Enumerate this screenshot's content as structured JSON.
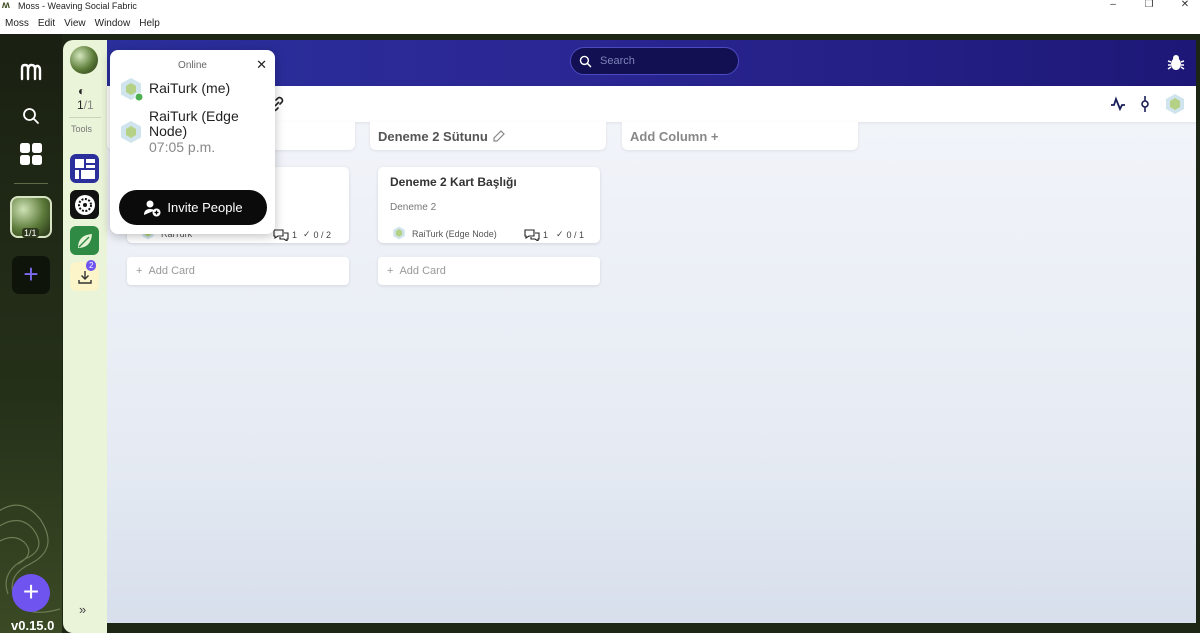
{
  "window": {
    "title": "Moss - Weaving Social Fabric",
    "controls": [
      "minimize",
      "restore",
      "close"
    ]
  },
  "menu": [
    "Moss",
    "Edit",
    "View",
    "Window",
    "Help"
  ],
  "rail": {
    "group_count": "1/1",
    "version": "v0.15.0"
  },
  "tools": {
    "ratio_main": "1",
    "ratio_sep": "/1",
    "label": "Tools",
    "badge": "2"
  },
  "topbar": {
    "search_placeholder": "Search"
  },
  "board": {
    "columns": [
      {
        "title": "Deneme 2 Sütunu"
      },
      {
        "title": "Add Column +"
      }
    ],
    "cards": [
      {
        "title": "Deneme 2 Kart Başlığı",
        "description": "Deneme 2",
        "user": "RaiTurk (Edge Node)",
        "comments": "1",
        "checklist": "0 / 1"
      },
      {
        "user": "RaiTurk",
        "comments": "1",
        "checklist": "0 / 2"
      }
    ],
    "add_card_label": "Add Card"
  },
  "popup": {
    "heading": "Online",
    "members": [
      {
        "name": "RaiTurk (me)"
      },
      {
        "name": "RaiTurk (Edge Node)",
        "time": "07:05 p.m."
      }
    ],
    "invite_label": "Invite People"
  },
  "colors": {
    "accent": "#6f54f0",
    "topbar": "#2a2f9c",
    "rail": "#1d2514"
  }
}
